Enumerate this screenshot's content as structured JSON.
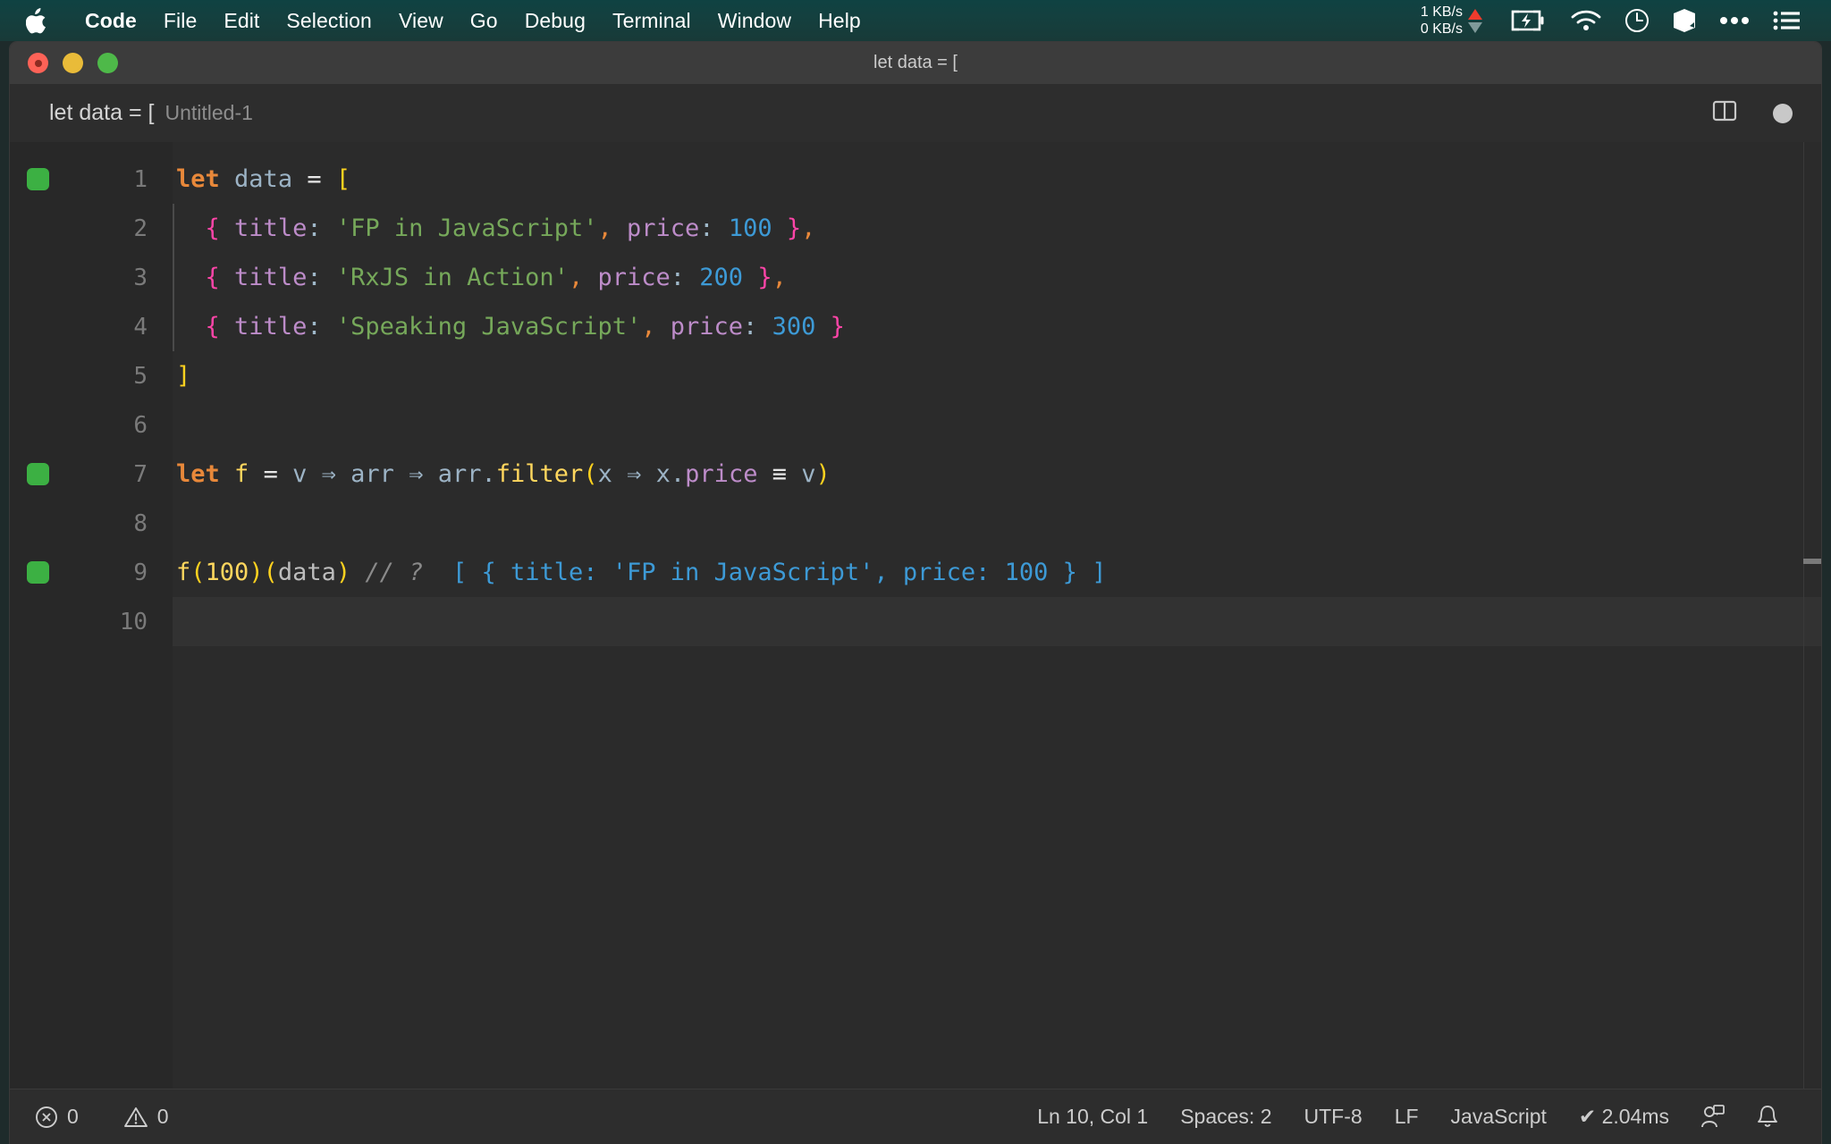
{
  "menubar": {
    "apple_icon": "apple-logo-icon",
    "items": [
      {
        "label": "Code",
        "bold": true
      },
      {
        "label": "File",
        "bold": false
      },
      {
        "label": "Edit",
        "bold": false
      },
      {
        "label": "Selection",
        "bold": false
      },
      {
        "label": "View",
        "bold": false
      },
      {
        "label": "Go",
        "bold": false
      },
      {
        "label": "Debug",
        "bold": false
      },
      {
        "label": "Terminal",
        "bold": false
      },
      {
        "label": "Window",
        "bold": false
      },
      {
        "label": "Help",
        "bold": false
      }
    ],
    "network": {
      "up": "1 KB/s",
      "down": "0 KB/s",
      "up_color": "#ef3b2d",
      "down_color": "#7f9a9a"
    },
    "status_icons": [
      "battery-charging-icon",
      "wifi-icon",
      "clock-icon",
      "cube-icon",
      "ellipsis-icon",
      "list-menu-icon"
    ]
  },
  "window": {
    "title": "let data = [",
    "traffic_lights": [
      "close-button",
      "minimize-button",
      "maximize-button"
    ]
  },
  "breadcrumb": {
    "main": "let data = [",
    "file": "Untitled-1"
  },
  "editor_actions": {
    "split_editor": "split-editor-icon",
    "dirty_indicator": "unsaved-changes-dot"
  },
  "editor": {
    "lines": [
      {
        "number": "1",
        "bookmark": true,
        "current": false,
        "indent_guide": false,
        "tokens": [
          {
            "text": "let",
            "cls": "t-kw"
          },
          {
            "text": " ",
            "cls": "t-op"
          },
          {
            "text": "data",
            "cls": "t-var"
          },
          {
            "text": " ",
            "cls": "t-op"
          },
          {
            "text": "=",
            "cls": "t-op"
          },
          {
            "text": " ",
            "cls": "t-op"
          },
          {
            "text": "[",
            "cls": "t-bracket"
          }
        ]
      },
      {
        "number": "2",
        "bookmark": false,
        "current": false,
        "indent_guide": true,
        "tokens": [
          {
            "text": "  ",
            "cls": "t-op"
          },
          {
            "text": "{",
            "cls": "t-brace"
          },
          {
            "text": " ",
            "cls": "t-op"
          },
          {
            "text": "title",
            "cls": "t-prop"
          },
          {
            "text": ":",
            "cls": "t-colon"
          },
          {
            "text": " ",
            "cls": "t-op"
          },
          {
            "text": "'FP in JavaScript'",
            "cls": "t-str"
          },
          {
            "text": ",",
            "cls": "t-comma"
          },
          {
            "text": " ",
            "cls": "t-op"
          },
          {
            "text": "price",
            "cls": "t-prop"
          },
          {
            "text": ":",
            "cls": "t-colon"
          },
          {
            "text": " ",
            "cls": "t-op"
          },
          {
            "text": "100",
            "cls": "t-num"
          },
          {
            "text": " ",
            "cls": "t-op"
          },
          {
            "text": "}",
            "cls": "t-brace"
          },
          {
            "text": ",",
            "cls": "t-comma"
          }
        ]
      },
      {
        "number": "3",
        "bookmark": false,
        "current": false,
        "indent_guide": true,
        "tokens": [
          {
            "text": "  ",
            "cls": "t-op"
          },
          {
            "text": "{",
            "cls": "t-brace"
          },
          {
            "text": " ",
            "cls": "t-op"
          },
          {
            "text": "title",
            "cls": "t-prop"
          },
          {
            "text": ":",
            "cls": "t-colon"
          },
          {
            "text": " ",
            "cls": "t-op"
          },
          {
            "text": "'RxJS in Action'",
            "cls": "t-str"
          },
          {
            "text": ",",
            "cls": "t-comma"
          },
          {
            "text": " ",
            "cls": "t-op"
          },
          {
            "text": "price",
            "cls": "t-prop"
          },
          {
            "text": ":",
            "cls": "t-colon"
          },
          {
            "text": " ",
            "cls": "t-op"
          },
          {
            "text": "200",
            "cls": "t-num"
          },
          {
            "text": " ",
            "cls": "t-op"
          },
          {
            "text": "}",
            "cls": "t-brace"
          },
          {
            "text": ",",
            "cls": "t-comma"
          }
        ]
      },
      {
        "number": "4",
        "bookmark": false,
        "current": false,
        "indent_guide": true,
        "tokens": [
          {
            "text": "  ",
            "cls": "t-op"
          },
          {
            "text": "{",
            "cls": "t-brace"
          },
          {
            "text": " ",
            "cls": "t-op"
          },
          {
            "text": "title",
            "cls": "t-prop"
          },
          {
            "text": ":",
            "cls": "t-colon"
          },
          {
            "text": " ",
            "cls": "t-op"
          },
          {
            "text": "'Speaking JavaScript'",
            "cls": "t-str"
          },
          {
            "text": ",",
            "cls": "t-comma"
          },
          {
            "text": " ",
            "cls": "t-op"
          },
          {
            "text": "price",
            "cls": "t-prop"
          },
          {
            "text": ":",
            "cls": "t-colon"
          },
          {
            "text": " ",
            "cls": "t-op"
          },
          {
            "text": "300",
            "cls": "t-num"
          },
          {
            "text": " ",
            "cls": "t-op"
          },
          {
            "text": "}",
            "cls": "t-brace"
          }
        ]
      },
      {
        "number": "5",
        "bookmark": false,
        "current": false,
        "indent_guide": false,
        "tokens": [
          {
            "text": "]",
            "cls": "t-bracket"
          }
        ]
      },
      {
        "number": "6",
        "bookmark": false,
        "current": false,
        "indent_guide": false,
        "tokens": []
      },
      {
        "number": "7",
        "bookmark": true,
        "current": false,
        "indent_guide": false,
        "tokens": [
          {
            "text": "let",
            "cls": "t-kw"
          },
          {
            "text": " ",
            "cls": "t-op"
          },
          {
            "text": "f",
            "cls": "t-fn"
          },
          {
            "text": " ",
            "cls": "t-op"
          },
          {
            "text": "=",
            "cls": "t-op"
          },
          {
            "text": " ",
            "cls": "t-op"
          },
          {
            "text": "v",
            "cls": "t-var"
          },
          {
            "text": " ",
            "cls": "t-op"
          },
          {
            "text": "⇒",
            "cls": "t-var"
          },
          {
            "text": " ",
            "cls": "t-op"
          },
          {
            "text": "arr",
            "cls": "t-var"
          },
          {
            "text": " ",
            "cls": "t-op"
          },
          {
            "text": "⇒",
            "cls": "t-var"
          },
          {
            "text": " ",
            "cls": "t-op"
          },
          {
            "text": "arr.",
            "cls": "t-var"
          },
          {
            "text": "filter",
            "cls": "t-fn"
          },
          {
            "text": "(",
            "cls": "t-bracket"
          },
          {
            "text": "x",
            "cls": "t-var"
          },
          {
            "text": " ",
            "cls": "t-op"
          },
          {
            "text": "⇒",
            "cls": "t-var"
          },
          {
            "text": " ",
            "cls": "t-op"
          },
          {
            "text": "x.",
            "cls": "t-var"
          },
          {
            "text": "price",
            "cls": "t-prop"
          },
          {
            "text": " ",
            "cls": "t-op"
          },
          {
            "text": "≡",
            "cls": "t-op"
          },
          {
            "text": " ",
            "cls": "t-op"
          },
          {
            "text": "v",
            "cls": "t-var"
          },
          {
            "text": ")",
            "cls": "t-bracket"
          }
        ]
      },
      {
        "number": "8",
        "bookmark": false,
        "current": false,
        "indent_guide": false,
        "tokens": []
      },
      {
        "number": "9",
        "bookmark": true,
        "current": false,
        "indent_guide": false,
        "tokens": [
          {
            "text": "f",
            "cls": "t-fn"
          },
          {
            "text": "(",
            "cls": "t-bracket"
          },
          {
            "text": "100",
            "cls": "t-fn"
          },
          {
            "text": ")",
            "cls": "t-bracket"
          },
          {
            "text": "(",
            "cls": "t-bracket"
          },
          {
            "text": "data",
            "cls": "t-gray"
          },
          {
            "text": ")",
            "cls": "t-bracket"
          },
          {
            "text": " ",
            "cls": "t-op"
          },
          {
            "text": "// ?",
            "cls": "t-comment"
          },
          {
            "text": "  ",
            "cls": "t-op"
          },
          {
            "text": "[ { title: 'FP in JavaScript', price: 100 } ]",
            "cls": "t-result"
          }
        ]
      },
      {
        "number": "10",
        "bookmark": false,
        "current": true,
        "indent_guide": false,
        "tokens": []
      }
    ],
    "raw_source": "let data = [\n  { title: 'FP in JavaScript', price: 100 },\n  { title: 'RxJS in Action', price: 200 },\n  { title: 'Speaking JavaScript', price: 300 }\n]\n\nlet f = v => arr => arr.filter(x => x.price === v)\n\nf(100)(data) // ?  [ { title: 'FP in JavaScript', price: 100 } ]\n"
  },
  "statusbar": {
    "errors": {
      "icon": "error-icon",
      "count": "0"
    },
    "warnings": {
      "icon": "warning-icon",
      "count": "0"
    },
    "cursor": "Ln 10, Col 1",
    "indentation": "Spaces: 2",
    "encoding": "UTF-8",
    "eol": "LF",
    "language": "JavaScript",
    "quokka": "✔ 2.04ms",
    "liveshare_icon": "live-share-icon",
    "bell_icon": "notifications-bell-icon"
  },
  "colors": {
    "menubar_bg": "#123f3e",
    "titlebar_bg": "#3c3c3c",
    "editor_bg": "#2b2b2b",
    "gutter_bg": "#282828",
    "statusbar_bg": "#2d2d2d",
    "bookmark_green": "#3cb043",
    "accent_yellow": "#ffd21f",
    "accent_pink": "#ff45a8"
  }
}
